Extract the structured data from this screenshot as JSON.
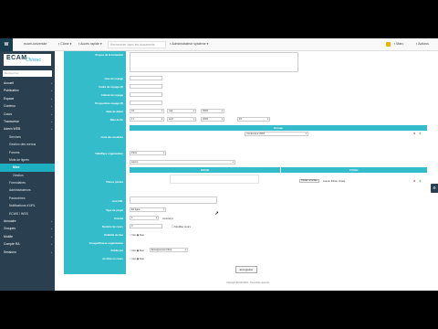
{
  "topbar": {
    "brand": "W",
    "site": "ecam-universite",
    "menu1": "Clone",
    "menu2": "Accès rapide",
    "search_placeholder": "Rechercher dans les documents",
    "menu3": "Administrateur système",
    "user": "Marc",
    "lang": "Actions"
  },
  "sidebar": {
    "logo": "ECAM",
    "logo_sub": "Chisrec",
    "search_placeholder": "Rechercher",
    "items": [
      {
        "label": "Accueil",
        "level": 0
      },
      {
        "label": "Publication",
        "level": 0
      },
      {
        "label": "Espace",
        "level": 0
      },
      {
        "label": "Contenu",
        "level": 0
      },
      {
        "label": "Cours",
        "level": 0
      },
      {
        "label": "Transverse",
        "level": 0
      },
      {
        "label": "Admin WEB",
        "level": 0
      },
      {
        "label": "Services",
        "level": 1
      },
      {
        "label": "Gestion des menus",
        "level": 1
      },
      {
        "label": "Forums",
        "level": 1
      },
      {
        "label": "Mots de lignes",
        "level": 1
      },
      {
        "label": "Mise",
        "level": 2,
        "active": true
      },
      {
        "label": "Gestion",
        "level": 2
      },
      {
        "label": "Formulaires",
        "level": 1
      },
      {
        "label": "Administrateurs",
        "level": 1
      },
      {
        "label": "Paramètres",
        "level": 1
      },
      {
        "label": "Notifications d'URL",
        "level": 1
      },
      {
        "label": "ECWS / WSS",
        "level": 1
      },
      {
        "label": "Annuaire",
        "level": 0
      },
      {
        "label": "Groupes",
        "level": 0
      },
      {
        "label": "Mobile",
        "level": 0
      },
      {
        "label": "Compte RA",
        "level": 0
      },
      {
        "label": "Sessions",
        "level": 0
      }
    ]
  },
  "form": {
    "labels": {
      "description": "Propos de la formation",
      "field2": "Lieu du voyage",
      "field3": "Cadre du voyage (2)",
      "field4": "Intitulé du voyage",
      "field5": "Prospection voyage (2)",
      "date_start": "Date de début",
      "date_end": "Date de fin",
      "courses": "Liste des modules",
      "ville": "Ville/Pays organisateur",
      "pieces": "Pièces jointes",
      "url": "Lien URL",
      "type": "Type de projet",
      "priority": "Priorité",
      "weight": "Nombre de cours",
      "visibility": "Visibilité du lien",
      "group": "Groupe/Classe organisation",
      "publisher": "Publié par",
      "archive": "Archivé en cours"
    },
    "date_start": {
      "day": "16",
      "month": "mai",
      "year": "2018"
    },
    "date_end": {
      "day": "17",
      "month": "avril",
      "year": "2018",
      "hour": "15"
    },
    "table_head": "Groupe",
    "table_value": "Conducteur 2018",
    "ville_value": "Paris",
    "ville_sub_value": "Aucun",
    "pieces_head_1": "Intitulé",
    "pieces_head_2": "Fichier",
    "file_button": "Choisir un fichier",
    "file_status": "Aucun fichier choisi",
    "type_value": "En ligne",
    "priority_value": "1",
    "priority_unit": "minute(s)",
    "weight_value": "0",
    "weight_suffix": "Modifier cours",
    "radio_yes": "Oui",
    "radio_no": "Non",
    "group_value": "Enseignement libre",
    "submit": "Enregistrer",
    "footer": "Copyright ECAM 2018 - Tous droits réservés"
  }
}
